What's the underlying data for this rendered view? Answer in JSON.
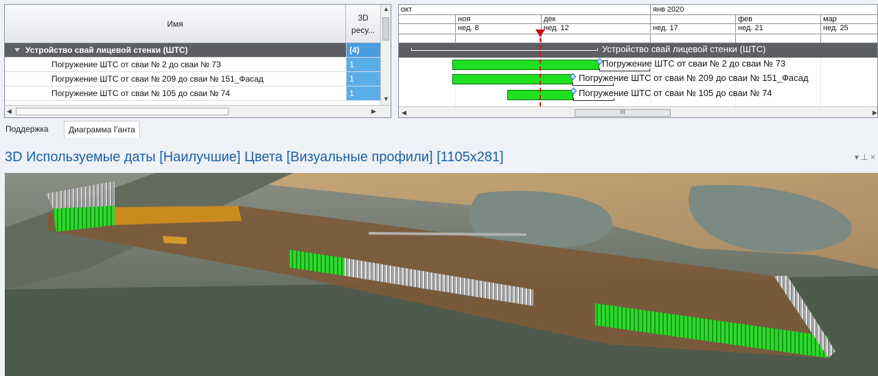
{
  "grid": {
    "columns": {
      "name": "Имя",
      "resources": "3D\nресу..."
    },
    "rows": [
      {
        "name": "Устройство свай лицевой стенки (ШТС)",
        "res": "(4)"
      },
      {
        "name": "Погружение ШТС от сваи № 2 до сваи № 73",
        "res": "1"
      },
      {
        "name": "Погружение ШТС от сваи № 209 до сваи № 151_Фасад",
        "res": "1"
      },
      {
        "name": "Погружение ШТС от сваи № 105 до сваи № 74",
        "res": "1"
      }
    ]
  },
  "gantt": {
    "months": {
      "oct": "окт",
      "nov": "ноя",
      "dec": "дек",
      "jan": "янв 2020",
      "feb": "фев",
      "mar": "мар"
    },
    "weeks": {
      "w8": "нед. 8",
      "w12": "нед. 12",
      "w17": "нед. 17",
      "w21": "нед. 21",
      "w25": "нед. 25"
    },
    "bar_labels": [
      "Устройство свай лицевой стенки (ШТС)",
      "Погружение ШТС от сваи № 2 до сваи № 73",
      "Погружение ШТС от сваи № 209 до сваи № 151_Фасад",
      "Погружение ШТС от сваи № 105 до сваи № 74"
    ],
    "scroll_thumb": "III",
    "bar_color": "#1fe01f",
    "today_color": "#d01818"
  },
  "tabs": {
    "support": "Поддержка",
    "gantt": "Диаграмма Ганта"
  },
  "view": {
    "title": "3D Используемые даты [Наилучшие] Цвета [Визуальные профили]  [1105x281]",
    "controls": "▾  ⊥  ×"
  }
}
